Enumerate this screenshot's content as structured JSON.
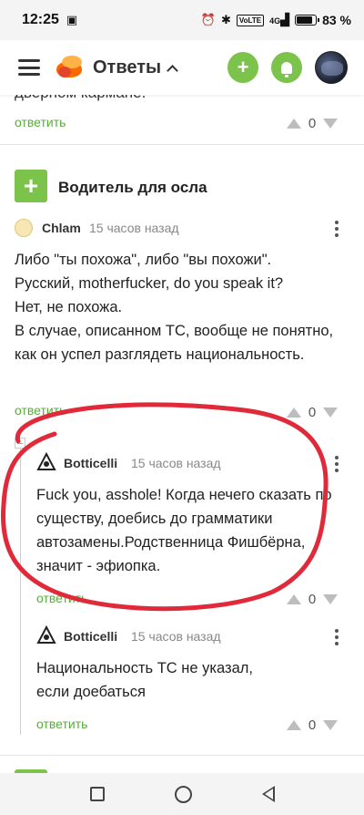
{
  "status_bar": {
    "time": "12:25",
    "battery_text": "83 %",
    "net_label": "4G",
    "volte_label": "VoLTE"
  },
  "header": {
    "title": "Ответы",
    "add_symbol": "+"
  },
  "prev_comment": {
    "clipped_text": "дверном кармане.",
    "reply_label": "ответить",
    "votes": "0"
  },
  "answer": {
    "add_symbol": "+",
    "author": "Водитель для осла"
  },
  "comments": [
    {
      "user": "Chlam",
      "time": "15 часов назад",
      "text": "Либо \"ты похожа\", либо \"вы похожи\".\nРусский, motherfucker, do you speak it?\nНет, не похожа.\nВ случае, описанном ТС, вообще не понятно, как он успел разглядеть национальность.",
      "reply_label": "ответить",
      "votes": "0"
    },
    {
      "user": "Botticelli",
      "time": "15 часов назад",
      "text": "Fuck you, asshole! Когда нечего сказать по существу, доебись до грамматики автозамены.Родственница Фишбёрна, значит - эфиопка.",
      "reply_label": "ответить",
      "votes": "0"
    },
    {
      "user": "Botticelli",
      "time": "15 часов назад",
      "text": "Национальность ТС не указал,\nесли доебаться",
      "reply_label": "ответить",
      "votes": "0"
    }
  ],
  "colors": {
    "accent_green": "#7bc34a",
    "reply_green": "#5aab3b",
    "annotation_red": "#e02a3a"
  }
}
